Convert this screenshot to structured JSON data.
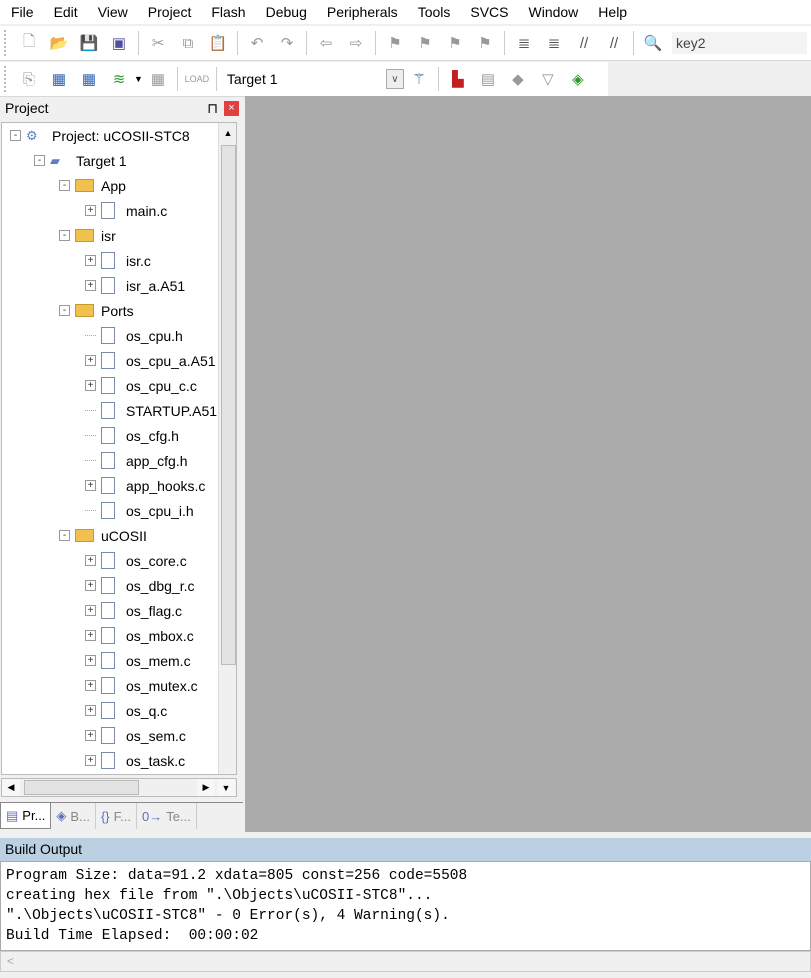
{
  "menu": [
    "File",
    "Edit",
    "View",
    "Project",
    "Flash",
    "Debug",
    "Peripherals",
    "Tools",
    "SVCS",
    "Window",
    "Help"
  ],
  "toolbar": {
    "find_value": "key2",
    "target_select": "Target 1"
  },
  "project_panel": {
    "title": "Project",
    "pin": "⊓",
    "close": "×"
  },
  "tree": [
    {
      "label": "Project: uCOSII-STC8",
      "level": 0,
      "exp": "-",
      "type": "project"
    },
    {
      "label": "Target 1",
      "level": 1,
      "exp": "-",
      "type": "target"
    },
    {
      "label": "App",
      "level": 2,
      "exp": "-",
      "type": "folder"
    },
    {
      "label": "main.c",
      "level": 3,
      "exp": "+",
      "type": "file"
    },
    {
      "label": "isr",
      "level": 2,
      "exp": "-",
      "type": "folder"
    },
    {
      "label": "isr.c",
      "level": 3,
      "exp": "+",
      "type": "file"
    },
    {
      "label": "isr_a.A51",
      "level": 3,
      "exp": "+",
      "type": "file"
    },
    {
      "label": "Ports",
      "level": 2,
      "exp": "-",
      "type": "folder"
    },
    {
      "label": "os_cpu.h",
      "level": 3,
      "exp": "",
      "type": "file"
    },
    {
      "label": "os_cpu_a.A51",
      "level": 3,
      "exp": "+",
      "type": "file"
    },
    {
      "label": "os_cpu_c.c",
      "level": 3,
      "exp": "+",
      "type": "file"
    },
    {
      "label": "STARTUP.A51",
      "level": 3,
      "exp": "",
      "type": "file"
    },
    {
      "label": "os_cfg.h",
      "level": 3,
      "exp": "",
      "type": "file"
    },
    {
      "label": "app_cfg.h",
      "level": 3,
      "exp": "",
      "type": "file"
    },
    {
      "label": "app_hooks.c",
      "level": 3,
      "exp": "+",
      "type": "file"
    },
    {
      "label": "os_cpu_i.h",
      "level": 3,
      "exp": "",
      "type": "file"
    },
    {
      "label": "uCOSII",
      "level": 2,
      "exp": "-",
      "type": "folder"
    },
    {
      "label": "os_core.c",
      "level": 3,
      "exp": "+",
      "type": "file"
    },
    {
      "label": "os_dbg_r.c",
      "level": 3,
      "exp": "+",
      "type": "file"
    },
    {
      "label": "os_flag.c",
      "level": 3,
      "exp": "+",
      "type": "file"
    },
    {
      "label": "os_mbox.c",
      "level": 3,
      "exp": "+",
      "type": "file"
    },
    {
      "label": "os_mem.c",
      "level": 3,
      "exp": "+",
      "type": "file"
    },
    {
      "label": "os_mutex.c",
      "level": 3,
      "exp": "+",
      "type": "file"
    },
    {
      "label": "os_q.c",
      "level": 3,
      "exp": "+",
      "type": "file"
    },
    {
      "label": "os_sem.c",
      "level": 3,
      "exp": "+",
      "type": "file"
    },
    {
      "label": "os_task.c",
      "level": 3,
      "exp": "+",
      "type": "file"
    }
  ],
  "panel_tabs": [
    {
      "label": "Pr...",
      "icon": "▤"
    },
    {
      "label": "B...",
      "icon": "◈"
    },
    {
      "label": "F...",
      "icon": "{}"
    },
    {
      "label": "Te...",
      "icon": "0→"
    }
  ],
  "build_output": {
    "title": "Build Output",
    "lines": [
      "Program Size: data=91.2 xdata=805 const=256 code=5508",
      "creating hex file from \".\\Objects\\uCOSII-STC8\"...",
      "\".\\Objects\\uCOSII-STC8\" - 0 Error(s), 4 Warning(s).",
      "Build Time Elapsed:  00:00:02"
    ]
  }
}
